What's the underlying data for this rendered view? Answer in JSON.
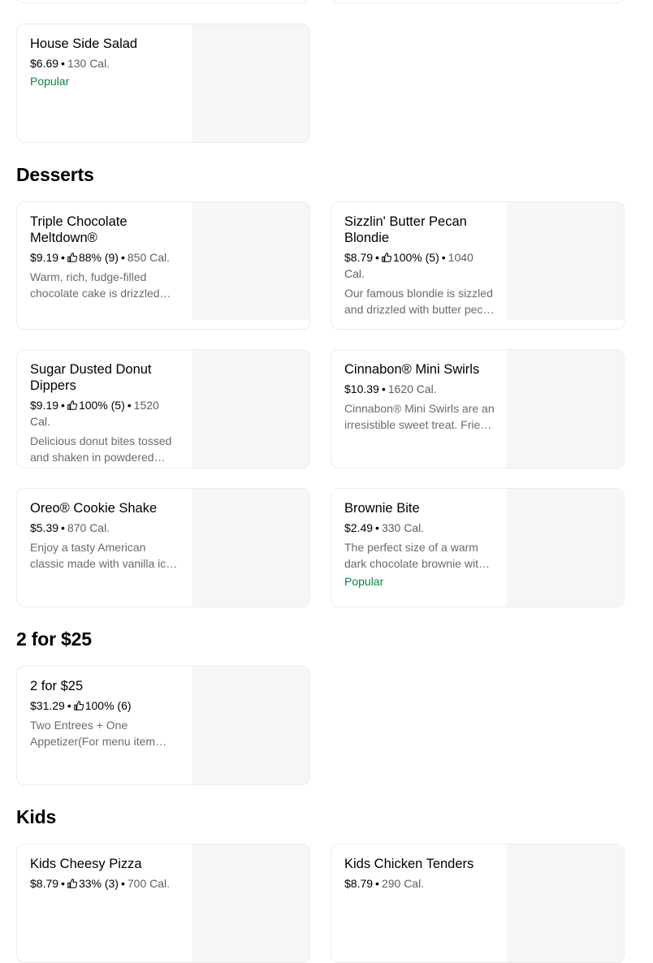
{
  "sections": {
    "desserts": "Desserts",
    "twofor": "2 for $25",
    "kids": "Kids"
  },
  "items": {
    "house_salad": {
      "name": "House Side Salad",
      "price": "$6.69",
      "cal": "130 Cal.",
      "popular": "Popular"
    },
    "triple_choc": {
      "name": "Triple Chocolate Meltdown®",
      "price": "$9.19",
      "rating": "88% (9)",
      "cal": "850 Cal.",
      "desc": "Warm, rich, fudge-filled chocolate cake is drizzled with hot fudge"
    },
    "pecan_blondie": {
      "name": "Sizzlin' Butter Pecan Blondie",
      "price": "$8.79",
      "rating": "100% (5)",
      "cal": "1040 Cal.",
      "desc": "Our famous blondie is sizzled and drizzled with butter pecan sauce"
    },
    "donut_dippers": {
      "name": "Sugar Dusted Donut Dippers",
      "price": "$9.19",
      "rating": "100% (5)",
      "cal": "1520 Cal.",
      "desc": "Delicious donut bites tossed and shaken in powdered sugar"
    },
    "cinnabon": {
      "name": "Cinnabon® Mini Swirls",
      "price": "$10.39",
      "cal": "1620 Cal.",
      "desc": "Cinnabon® Mini Swirls are an irresistible sweet treat. Fried to perfection"
    },
    "oreo_shake": {
      "name": "Oreo® Cookie Shake",
      "price": "$5.39",
      "cal": "870 Cal.",
      "desc": "Enjoy a tasty American classic made with vanilla ice cream"
    },
    "brownie_bite": {
      "name": "Brownie Bite",
      "price": "$2.49",
      "cal": "330 Cal.",
      "desc": "The perfect size of a warm dark chocolate brownie with ice cream",
      "popular": "Popular"
    },
    "two_for_25": {
      "name": "2 for $25",
      "price": "$31.29",
      "rating": "100% (6)",
      "desc": "Two Entrees + One Appetizer(For menu item details)"
    },
    "kids_pizza": {
      "name": "Kids Cheesy Pizza",
      "price": "$8.79",
      "rating": "33% (3)",
      "cal": "700 Cal."
    },
    "kids_tenders": {
      "name": "Kids Chicken Tenders",
      "price": "$8.79",
      "cal": "290 Cal."
    }
  },
  "colors": {
    "popular": "#0e8345",
    "border": "#ececec",
    "thumb": "#f6f6f6"
  },
  "icons": {
    "rating": "thumbs-up-icon"
  }
}
